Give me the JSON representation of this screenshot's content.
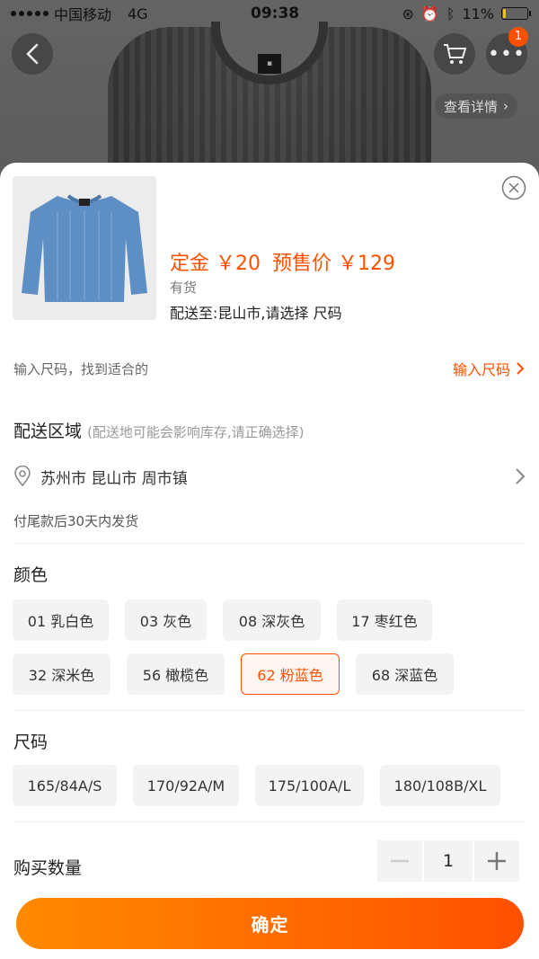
{
  "status_bar": {
    "carrier": "中国移动",
    "network": "4G",
    "time": "09:38",
    "battery": "11%",
    "battery_level": 0.11
  },
  "header": {
    "cart_badge": "1",
    "detail_label": "查看详情"
  },
  "sheet": {
    "price": {
      "deposit_label": "定金",
      "deposit_value": "￥20",
      "presale_label": "预售价",
      "presale_value": "￥129"
    },
    "stock": "有货",
    "shipping": "配送至:昆山市,请选择 尺码",
    "size_finder": {
      "hint": "输入尺码，找到适合的",
      "link": "输入尺码"
    },
    "region": {
      "title": "配送区域",
      "note": "(配送地可能会影响库存,请正确选择)",
      "address": "苏州市 昆山市 周市镇"
    },
    "delivery_note": "付尾款后30天内发货",
    "color": {
      "label": "颜色",
      "options": [
        "01 乳白色",
        "03 灰色",
        "08 深灰色",
        "17 枣红色",
        "32 深米色",
        "56 橄榄色",
        "62 粉蓝色",
        "68 深蓝色"
      ],
      "selected": "62 粉蓝色"
    },
    "size": {
      "label": "尺码",
      "options": [
        "165/84A/S",
        "170/92A/M",
        "175/100A/L",
        "180/108B/XL"
      ]
    },
    "quantity": {
      "label": "购买数量",
      "value": "1"
    },
    "confirm": "确定"
  },
  "colors": {
    "accent": "#ff5000",
    "thumb_sweater": "#5e8fc4"
  }
}
